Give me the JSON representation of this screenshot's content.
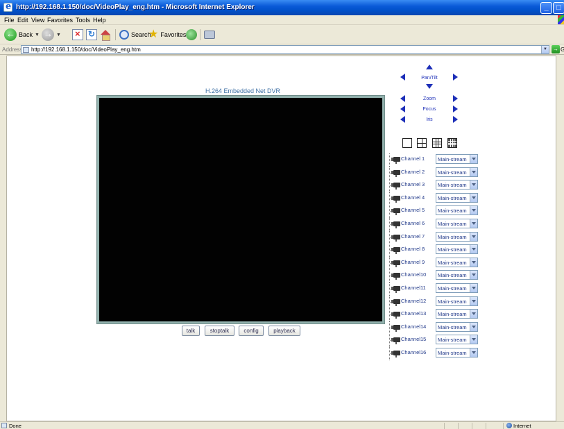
{
  "window": {
    "title": "http://192.168.1.150/doc/VideoPlay_eng.htm - Microsoft Internet Explorer"
  },
  "menu": [
    "File",
    "Edit",
    "View",
    "Favorites",
    "Tools",
    "Help"
  ],
  "toolbar": {
    "back_label": "Back",
    "search_label": "Search",
    "favorites_label": "Favorites"
  },
  "address": {
    "label": "Address",
    "url": "http://192.168.1.150/doc/VideoPlay_eng.htm",
    "go_label": "Go"
  },
  "page": {
    "title": "H.264 Embedded Net DVR",
    "buttons": {
      "talk": "talk",
      "stoptalk": "stoptalk",
      "config": "config",
      "playback": "playback"
    },
    "ptz": {
      "pan_tilt": "Pan/Tilt",
      "zoom": "Zoom",
      "focus": "Focus",
      "iris": "Iris"
    },
    "channels": [
      {
        "label": "Channel 1",
        "stream": "Main-stream"
      },
      {
        "label": "Channel 2",
        "stream": "Main-stream"
      },
      {
        "label": "Channel 3",
        "stream": "Main-stream"
      },
      {
        "label": "Channel 4",
        "stream": "Main-stream"
      },
      {
        "label": "Channel 5",
        "stream": "Main-stream"
      },
      {
        "label": "Channel 6",
        "stream": "Main-stream"
      },
      {
        "label": "Channel 7",
        "stream": "Main-stream"
      },
      {
        "label": "Channel 8",
        "stream": "Main-stream"
      },
      {
        "label": "Channel 9",
        "stream": "Main-stream"
      },
      {
        "label": "Channel10",
        "stream": "Main-stream"
      },
      {
        "label": "Channel11",
        "stream": "Main-stream"
      },
      {
        "label": "Channel12",
        "stream": "Main-stream"
      },
      {
        "label": "Channel13",
        "stream": "Main-stream"
      },
      {
        "label": "Channel14",
        "stream": "Main-stream"
      },
      {
        "label": "Channel15",
        "stream": "Main-stream"
      },
      {
        "label": "Channel16",
        "stream": "Main-stream"
      }
    ]
  },
  "status": {
    "text": "Done",
    "zone": "Internet"
  },
  "colors": {
    "titlebar": "#0a5ad8",
    "link_blue": "#3c6ea3",
    "arrow_blue": "#1d2fb8",
    "video_bg": "#020202",
    "video_border": "#93b2ae"
  }
}
